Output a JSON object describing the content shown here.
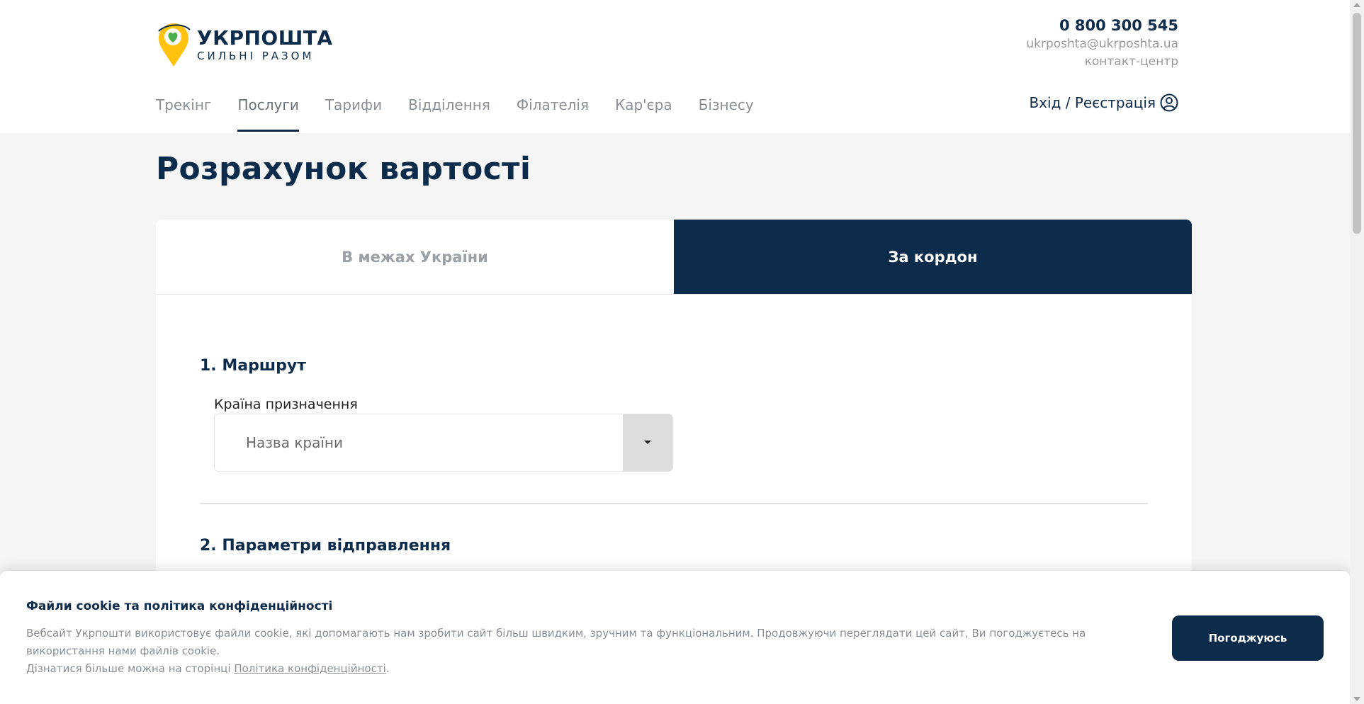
{
  "brand": {
    "name": "УКРПОШТА",
    "slogan": "СИЛЬНІ РАЗОМ",
    "logo_icon": "pin-heart-icon",
    "colors": {
      "primary": "#0d2c4b",
      "accent": "#ffc20e",
      "heart": "#4cae4f"
    }
  },
  "contacts": {
    "phone": "0 800 300 545",
    "email": "ukrposhta@ukrposhta.ua",
    "label": "контакт-центр"
  },
  "nav": {
    "items": [
      {
        "label": "Трекінг"
      },
      {
        "label": "Послуги",
        "active": true
      },
      {
        "label": "Тарифи"
      },
      {
        "label": "Відділення"
      },
      {
        "label": "Філателія"
      },
      {
        "label": "Кар'єра"
      },
      {
        "label": "Бізнесу"
      }
    ],
    "auth_label": "Вхід / Реєстрація",
    "auth_icon": "user-circle-icon"
  },
  "page": {
    "title": "Розрахунок вартості"
  },
  "tabs": [
    {
      "label": "В межах України",
      "active": false
    },
    {
      "label": "За кордон",
      "active": true
    }
  ],
  "form": {
    "section1_title": "1. Маршрут",
    "country_label": "Країна призначення",
    "country_placeholder": "Назва країни",
    "dropdown_icon": "caret-down-icon",
    "section2_title": "2. Параметри відправлення"
  },
  "cookie": {
    "title": "Файли cookie та політика конфіденційності",
    "text": "Вебсайт Укрпошти використовує файли cookie, які допомагають нам зробити сайт більш швидким, зручним та функціональним. Продовжуючи переглядати цей сайт, Ви погоджуєтесь на використання нами файлів cookie.",
    "more_prefix": "Дізнатися більше можна на сторінці",
    "link_label": "Політика конфіденційності",
    "more_suffix": ".",
    "accept_label": "Погоджуюсь"
  }
}
